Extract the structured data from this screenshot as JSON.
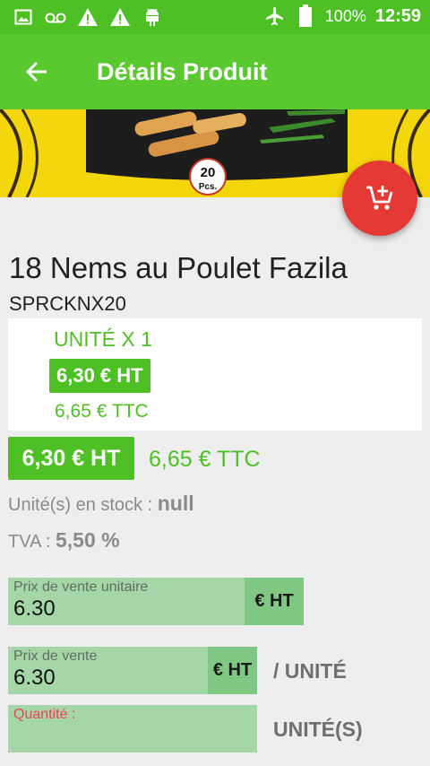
{
  "status_bar": {
    "icons_left": [
      "image-icon",
      "voicemail-icon",
      "warning-icon",
      "warning-icon",
      "android-icon"
    ],
    "battery_percent": "100%",
    "time": "12:59"
  },
  "app_bar": {
    "title": "Détails Produit"
  },
  "product": {
    "name": "18 Nems au Poulet Fazila",
    "sku": "SPRCKNX20",
    "image_badge": "20",
    "image_badge_unit": "Pcs."
  },
  "unit_card": {
    "label": "UNITÉ X 1",
    "price_ht": "6,30 € HT",
    "price_ttc": "6,65 € TTC"
  },
  "price": {
    "ht": "6,30 € HT",
    "ttc": "6,65 € TTC"
  },
  "stock": {
    "label": "Unité(s) en stock : ",
    "value": "null"
  },
  "tva": {
    "label": "TVA : ",
    "value": "5,50 %"
  },
  "form": {
    "unit_price": {
      "label": "Prix de vente unitaire",
      "value": "6.30",
      "suffix": "€ HT"
    },
    "sale_price": {
      "label": "Prix de vente",
      "value": "6.30",
      "suffix": "€ HT",
      "unit": "/ UNITÉ"
    },
    "quantity": {
      "label": "Quantité :",
      "value": "",
      "unit": "UNITÉ(S)"
    }
  },
  "colors": {
    "primary": "#5ac92f",
    "status_bar": "#4fbf26",
    "fab": "#e53935",
    "field": "#a5d6a7"
  }
}
